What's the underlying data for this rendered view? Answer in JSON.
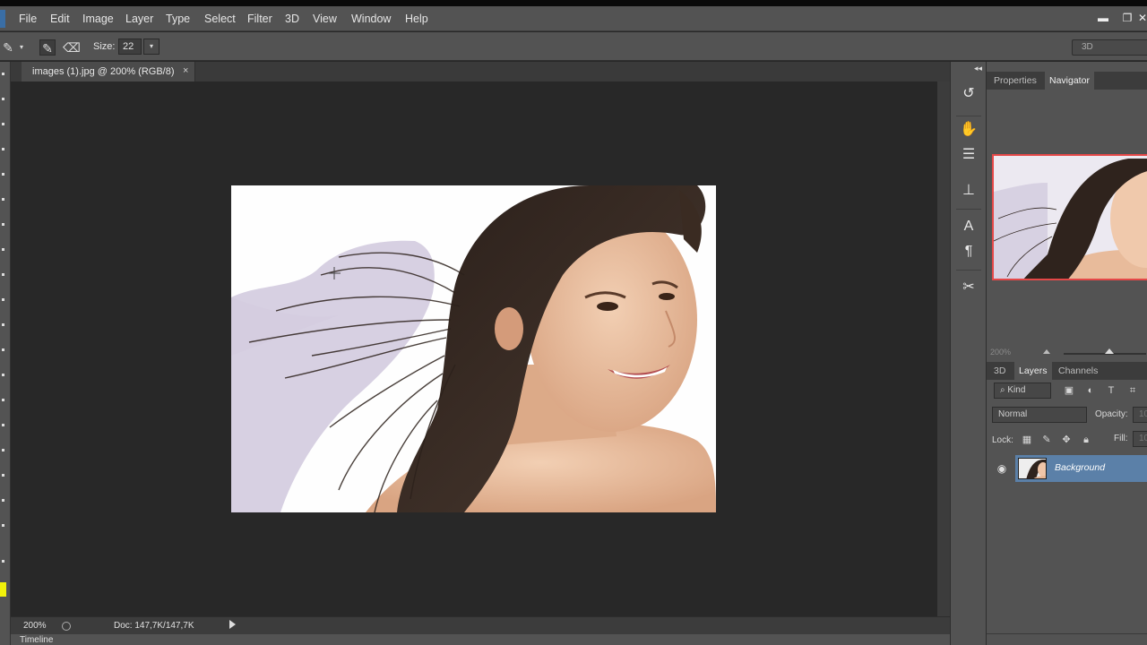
{
  "menu": {
    "items": [
      "File",
      "Edit",
      "Image",
      "Layer",
      "Type",
      "Select",
      "Filter",
      "3D",
      "View",
      "Window",
      "Help"
    ]
  },
  "window_controls": {
    "minimize_icon": "minimize-icon",
    "restore_icon": "restore-icon"
  },
  "options_bar": {
    "size_label": "Size:",
    "size_value": "22",
    "workspace_value": "3D"
  },
  "document": {
    "tab_title": "images (1).jpg @ 200% (RGB/8)",
    "tab_close": "×"
  },
  "status_bar": {
    "zoom": "200%",
    "doc_info": "Doc: 147,7K/147,7K"
  },
  "timeline": {
    "label": "Timeline"
  },
  "panels_top": {
    "tabs": [
      "Properties",
      "Navigator"
    ],
    "active": "Navigator",
    "nav_zoom": "200%"
  },
  "panels_layers": {
    "tabs": [
      "3D",
      "Layers",
      "Channels"
    ],
    "active": "Layers",
    "filter_kind": "Kind",
    "blend_mode": "Normal",
    "opacity_label": "Opacity:",
    "opacity_value": "10",
    "lock_label": "Lock:",
    "fill_label": "Fill:",
    "fill_value": "10",
    "layers": [
      {
        "name": "Background",
        "visible": true,
        "selected": true
      }
    ]
  },
  "colors": {
    "ui_bg": "#535353",
    "canvas_bg": "#282828",
    "selection_blue": "#5b80a8",
    "foreground_swatch": "#f2f20a",
    "navigator_frame": "#e54848"
  }
}
